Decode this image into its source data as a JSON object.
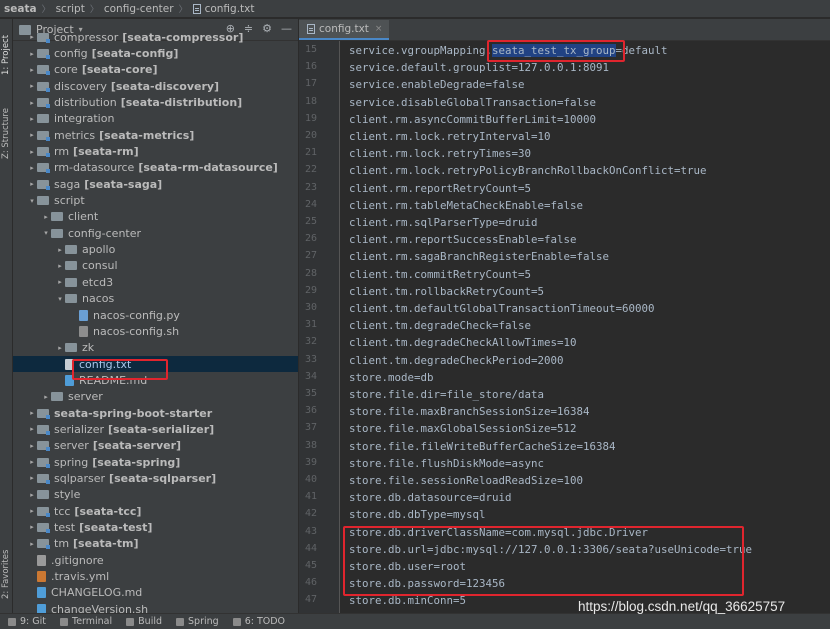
{
  "breadcrumb": {
    "items": [
      "seata",
      "script",
      "config-center",
      "config.txt"
    ]
  },
  "side_tabs": {
    "project": "1: Project",
    "structure": "Z: Structure",
    "favorites": "2: Favorites"
  },
  "project_panel": {
    "title": "Project",
    "title_dropdown_icon": "chevron-down-icon",
    "tools": [
      "crosshair-icon",
      "collapse-icon",
      "gear-icon",
      "minimize-icon"
    ]
  },
  "tree": [
    {
      "indent": 0,
      "arrow": "▸",
      "icon": "module",
      "name": "compressor",
      "module": "[seata-compressor]"
    },
    {
      "indent": 0,
      "arrow": "▸",
      "icon": "module",
      "name": "config",
      "module": "[seata-config]"
    },
    {
      "indent": 0,
      "arrow": "▸",
      "icon": "module",
      "name": "core",
      "module": "[seata-core]"
    },
    {
      "indent": 0,
      "arrow": "▸",
      "icon": "module",
      "name": "discovery",
      "module": "[seata-discovery]"
    },
    {
      "indent": 0,
      "arrow": "▸",
      "icon": "module",
      "name": "distribution",
      "module": "[seata-distribution]"
    },
    {
      "indent": 0,
      "arrow": "▸",
      "icon": "folder",
      "name": "integration",
      "module": ""
    },
    {
      "indent": 0,
      "arrow": "▸",
      "icon": "module",
      "name": "metrics",
      "module": "[seata-metrics]"
    },
    {
      "indent": 0,
      "arrow": "▸",
      "icon": "module",
      "name": "rm",
      "module": "[seata-rm]"
    },
    {
      "indent": 0,
      "arrow": "▸",
      "icon": "module",
      "name": "rm-datasource",
      "module": "[seata-rm-datasource]"
    },
    {
      "indent": 0,
      "arrow": "▸",
      "icon": "module",
      "name": "saga",
      "module": "[seata-saga]"
    },
    {
      "indent": 0,
      "arrow": "▾",
      "icon": "folder",
      "name": "script",
      "module": ""
    },
    {
      "indent": 1,
      "arrow": "▸",
      "icon": "folder",
      "name": "client",
      "module": ""
    },
    {
      "indent": 1,
      "arrow": "▾",
      "icon": "folder",
      "name": "config-center",
      "module": ""
    },
    {
      "indent": 2,
      "arrow": "▸",
      "icon": "folder",
      "name": "apollo",
      "module": ""
    },
    {
      "indent": 2,
      "arrow": "▸",
      "icon": "folder",
      "name": "consul",
      "module": ""
    },
    {
      "indent": 2,
      "arrow": "▸",
      "icon": "folder",
      "name": "etcd3",
      "module": ""
    },
    {
      "indent": 2,
      "arrow": "▾",
      "icon": "folder",
      "name": "nacos",
      "module": ""
    },
    {
      "indent": 3,
      "arrow": "",
      "icon": "py",
      "name": "nacos-config.py",
      "module": ""
    },
    {
      "indent": 3,
      "arrow": "",
      "icon": "sh",
      "name": "nacos-config.sh",
      "module": ""
    },
    {
      "indent": 2,
      "arrow": "▸",
      "icon": "folder",
      "name": "zk",
      "module": ""
    },
    {
      "indent": 2,
      "arrow": "",
      "icon": "txt",
      "name": "config.txt",
      "module": "",
      "selected": true
    },
    {
      "indent": 2,
      "arrow": "",
      "icon": "md",
      "name": "README.md",
      "module": ""
    },
    {
      "indent": 1,
      "arrow": "▸",
      "icon": "folder",
      "name": "server",
      "module": ""
    },
    {
      "indent": 0,
      "arrow": "▸",
      "icon": "module",
      "name": "seata-spring-boot-starter",
      "module": "",
      "bold": true
    },
    {
      "indent": 0,
      "arrow": "▸",
      "icon": "module",
      "name": "serializer",
      "module": "[seata-serializer]"
    },
    {
      "indent": 0,
      "arrow": "▸",
      "icon": "module",
      "name": "server",
      "module": "[seata-server]"
    },
    {
      "indent": 0,
      "arrow": "▸",
      "icon": "module",
      "name": "spring",
      "module": "[seata-spring]"
    },
    {
      "indent": 0,
      "arrow": "▸",
      "icon": "module",
      "name": "sqlparser",
      "module": "[seata-sqlparser]"
    },
    {
      "indent": 0,
      "arrow": "▸",
      "icon": "folder",
      "name": "style",
      "module": ""
    },
    {
      "indent": 0,
      "arrow": "▸",
      "icon": "module",
      "name": "tcc",
      "module": "[seata-tcc]"
    },
    {
      "indent": 0,
      "arrow": "▸",
      "icon": "module",
      "name": "test",
      "module": "[seata-test]"
    },
    {
      "indent": 0,
      "arrow": "▸",
      "icon": "module",
      "name": "tm",
      "module": "[seata-tm]"
    },
    {
      "indent": 0,
      "arrow": "",
      "icon": "git",
      "name": ".gitignore",
      "module": ""
    },
    {
      "indent": 0,
      "arrow": "",
      "icon": "yml",
      "name": ".travis.yml",
      "module": ""
    },
    {
      "indent": 0,
      "arrow": "",
      "icon": "md",
      "name": "CHANGELOG.md",
      "module": ""
    },
    {
      "indent": 0,
      "arrow": "",
      "icon": "md",
      "name": "changeVersion.sh",
      "module": ""
    }
  ],
  "editor": {
    "tab_label": "config.txt",
    "tab_close": "×",
    "first_line_number": 15,
    "selected_text": "seata_test_tx_group",
    "lines": [
      "service.vgroupMapping.seata_test_tx_group=default",
      "service.default.grouplist=127.0.0.1:8091",
      "service.enableDegrade=false",
      "service.disableGlobalTransaction=false",
      "client.rm.asyncCommitBufferLimit=10000",
      "client.rm.lock.retryInterval=10",
      "client.rm.lock.retryTimes=30",
      "client.rm.lock.retryPolicyBranchRollbackOnConflict=true",
      "client.rm.reportRetryCount=5",
      "client.rm.tableMetaCheckEnable=false",
      "client.rm.sqlParserType=druid",
      "client.rm.reportSuccessEnable=false",
      "client.rm.sagaBranchRegisterEnable=false",
      "client.tm.commitRetryCount=5",
      "client.tm.rollbackRetryCount=5",
      "client.tm.defaultGlobalTransactionTimeout=60000",
      "client.tm.degradeCheck=false",
      "client.tm.degradeCheckAllowTimes=10",
      "client.tm.degradeCheckPeriod=2000",
      "store.mode=db",
      "store.file.dir=file_store/data",
      "store.file.maxBranchSessionSize=16384",
      "store.file.maxGlobalSessionSize=512",
      "store.file.fileWriteBufferCacheSize=16384",
      "store.file.flushDiskMode=async",
      "store.file.sessionReloadReadSize=100",
      "store.db.datasource=druid",
      "store.db.dbType=mysql",
      "store.db.driverClassName=com.mysql.jdbc.Driver",
      "store.db.url=jdbc:mysql://127.0.0.1:3306/seata?useUnicode=true",
      "store.db.user=root",
      "store.db.password=123456",
      "store.db.minConn=5"
    ]
  },
  "statusbar": {
    "items": [
      {
        "icon": "git-icon",
        "label": "9: Git"
      },
      {
        "icon": "terminal-icon",
        "label": "Terminal"
      },
      {
        "icon": "build-icon",
        "label": "Build"
      },
      {
        "icon": "spring-icon",
        "label": "Spring"
      },
      {
        "icon": "todo-icon",
        "label": "6: TODO"
      }
    ]
  },
  "watermark": "https://blog.csdn.net/qq_36625757",
  "colors": {
    "highlight_box": "#e0252e",
    "selection": "#214283",
    "tree_selection": "#0d293e"
  }
}
